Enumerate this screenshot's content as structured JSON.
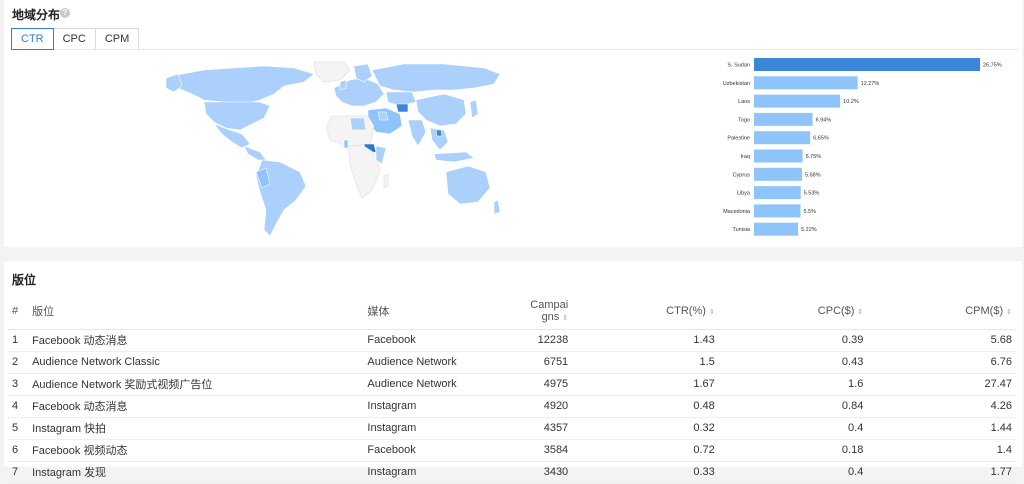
{
  "geo": {
    "title": "地域分布",
    "help_icon": "?",
    "tabs": [
      {
        "label": "CTR",
        "active": true
      },
      {
        "label": "CPC",
        "active": false
      },
      {
        "label": "CPM",
        "active": false
      }
    ]
  },
  "map_colors": {
    "land": "#f4f4f4",
    "low": "#aad0fb",
    "high": "#3b86d9",
    "water": "#ffffff"
  },
  "chart_data": {
    "type": "bar",
    "orientation": "horizontal",
    "metric": "CTR",
    "categories": [
      "S. Sudan",
      "Uzbekistan",
      "Laos",
      "Togo",
      "Palestine",
      "Iraq",
      "Cyprus",
      "Libya",
      "Macedonia",
      "Tunisia"
    ],
    "values": [
      26.75,
      12.27,
      10.2,
      6.94,
      6.65,
      5.75,
      5.68,
      5.53,
      5.5,
      5.22
    ],
    "data_labels": [
      "26.75%",
      "12.27%",
      "10.2%",
      "6.94%",
      "6.65%",
      "5.75%",
      "5.68%",
      "5.53%",
      "5.5%",
      "5.22%"
    ],
    "colors": {
      "top": "#3a86d8",
      "rest": "#8fc4fb"
    },
    "xlim": [
      0,
      26.75
    ]
  },
  "placement": {
    "title": "版位",
    "columns": {
      "num": "#",
      "placement": "版位",
      "media": "媒体",
      "campaigns_1": "Campai",
      "campaigns_2": "gns",
      "ctr": "CTR(%)",
      "cpc": "CPC($)",
      "cpm": "CPM($)",
      "sort_icon": "⇕"
    },
    "rows": [
      {
        "num": "1",
        "placement": "Facebook 动态消息",
        "media": "Facebook",
        "campaigns": "12238",
        "ctr": "1.43",
        "cpc": "0.39",
        "cpm": "5.68"
      },
      {
        "num": "2",
        "placement": "Audience Network Classic",
        "media": "Audience Network",
        "campaigns": "6751",
        "ctr": "1.5",
        "cpc": "0.43",
        "cpm": "6.76"
      },
      {
        "num": "3",
        "placement": "Audience Network 奖励式视频广告位",
        "media": "Audience Network",
        "campaigns": "4975",
        "ctr": "1.67",
        "cpc": "1.6",
        "cpm": "27.47"
      },
      {
        "num": "4",
        "placement": "Facebook 动态消息",
        "media": "Instagram",
        "campaigns": "4920",
        "ctr": "0.48",
        "cpc": "0.84",
        "cpm": "4.26"
      },
      {
        "num": "5",
        "placement": "Instagram 快拍",
        "media": "Instagram",
        "campaigns": "4357",
        "ctr": "0.32",
        "cpc": "0.4",
        "cpm": "1.44"
      },
      {
        "num": "6",
        "placement": "Facebook 视频动态",
        "media": "Facebook",
        "campaigns": "3584",
        "ctr": "0.72",
        "cpc": "0.18",
        "cpm": "1.4"
      },
      {
        "num": "7",
        "placement": "Instagram 发现",
        "media": "Instagram",
        "campaigns": "3430",
        "ctr": "0.33",
        "cpc": "0.4",
        "cpm": "1.77"
      }
    ]
  }
}
